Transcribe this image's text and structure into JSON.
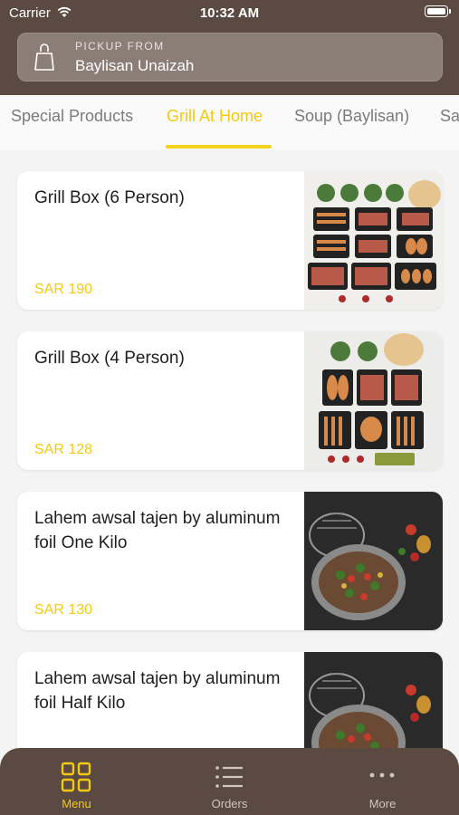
{
  "status_bar": {
    "carrier": "Carrier",
    "time": "10:32 AM"
  },
  "pickup": {
    "label": "PICKUP FROM",
    "location": "Baylisan Unaizah",
    "icon": "shopping-bag-icon"
  },
  "categories": {
    "tabs": [
      {
        "label": "Special Products",
        "active": false
      },
      {
        "label": "Grill At Home",
        "active": true
      },
      {
        "label": "Soup (Baylisan)",
        "active": false
      },
      {
        "label": "Sa",
        "active": false
      }
    ]
  },
  "products": [
    {
      "name": "Grill Box (6 Person)",
      "price": "SAR 190"
    },
    {
      "name": "Grill Box (4 Person)",
      "price": "SAR 128"
    },
    {
      "name": "Lahem awsal tajen by aluminum foil One Kilo",
      "price": "SAR 130"
    },
    {
      "name": "Lahem awsal tajen by aluminum foil Half Kilo",
      "price": ""
    }
  ],
  "tabbar": {
    "items": [
      {
        "label": "Menu",
        "icon": "grid-icon",
        "active": true
      },
      {
        "label": "Orders",
        "icon": "list-icon",
        "active": false
      },
      {
        "label": "More",
        "icon": "more-dots-icon",
        "active": false
      }
    ]
  },
  "colors": {
    "header": "#5a4a42",
    "accent": "#f3c913",
    "background": "#f4f4f4"
  }
}
